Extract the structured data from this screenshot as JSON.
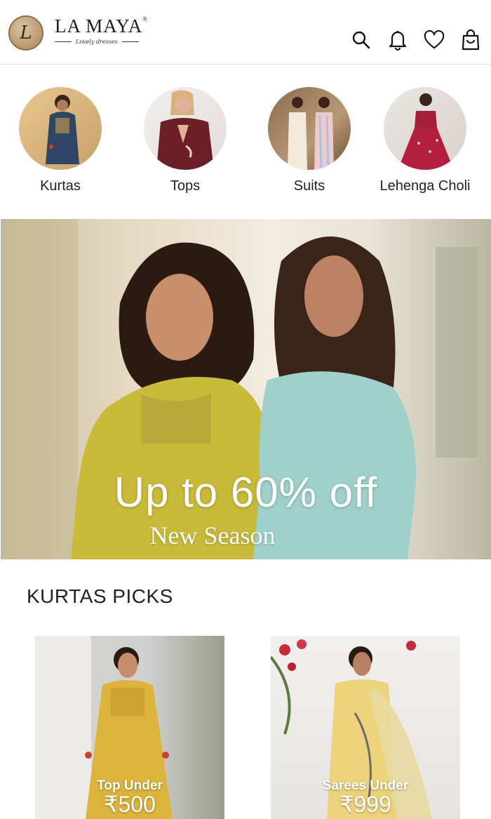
{
  "header": {
    "brand_name": "LA MAYA",
    "brand_reg": "®",
    "brand_tagline": "Lovely dresses",
    "icons": [
      "search-icon",
      "bell-icon",
      "heart-icon",
      "shopping-bag-icon"
    ]
  },
  "categories": [
    {
      "label": "Kurtas"
    },
    {
      "label": "Tops"
    },
    {
      "label": "Suits"
    },
    {
      "label": "Lehenga Choli"
    }
  ],
  "banner": {
    "title": "Up to 60% off",
    "subtitle": "New Season"
  },
  "section": {
    "title": "KURTAS PICKS"
  },
  "products": [
    {
      "caption": "Top Under",
      "price": "₹500"
    },
    {
      "caption": "Sarees Under",
      "price": "₹999"
    }
  ],
  "colors": {
    "accent_gold": "#b8976c",
    "text": "#222222",
    "divider": "#e6e6e6"
  }
}
